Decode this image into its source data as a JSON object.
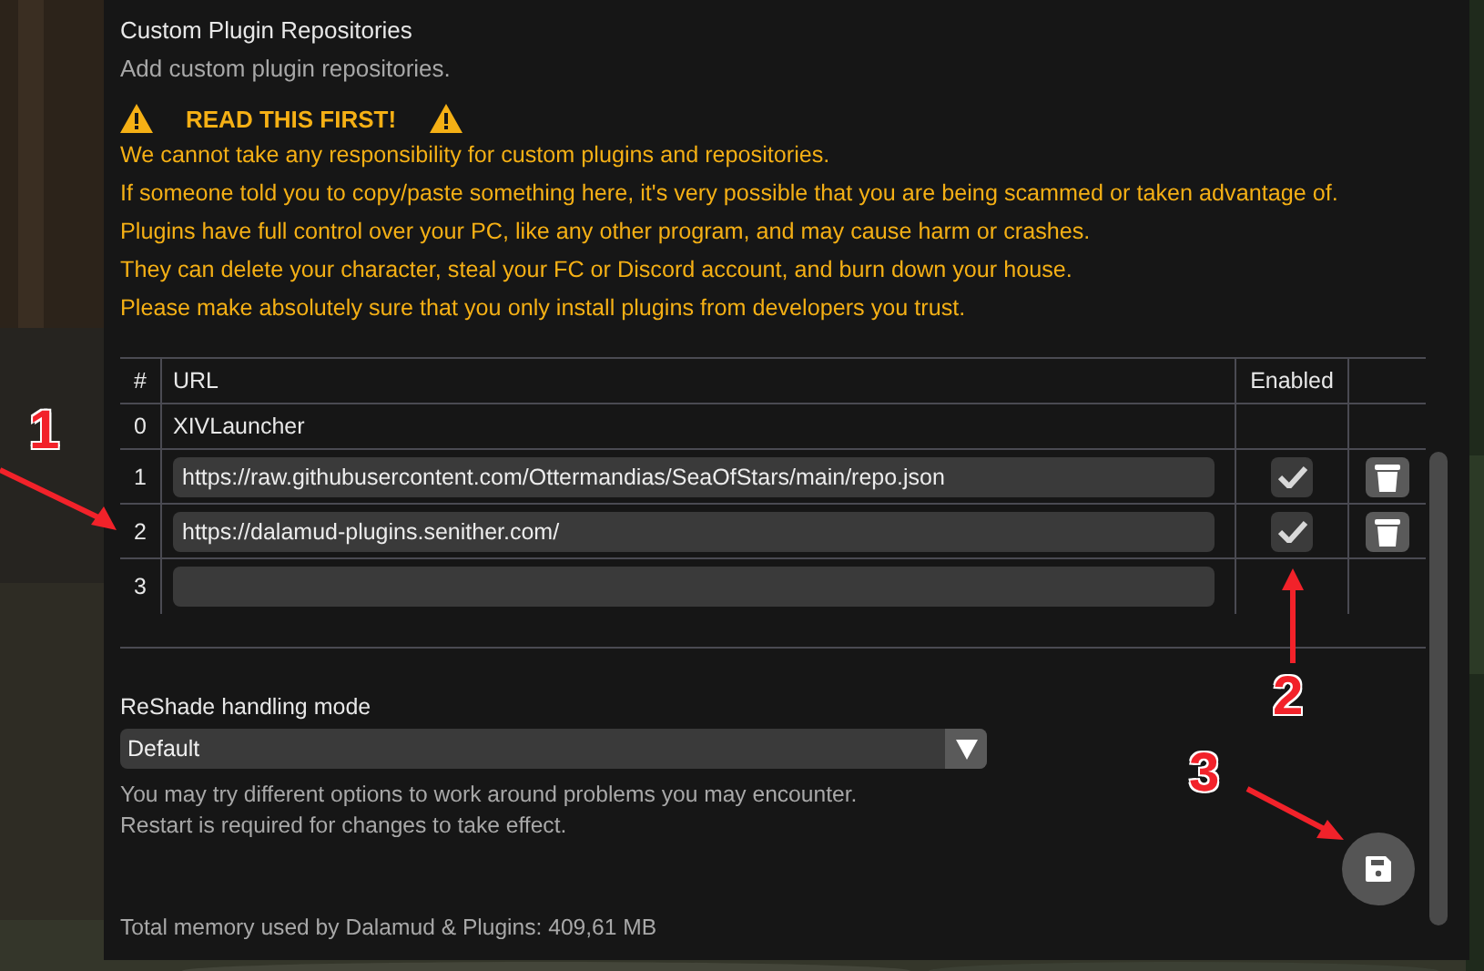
{
  "section": {
    "title": "Custom Plugin Repositories",
    "description": "Add custom plugin repositories."
  },
  "warning": {
    "heading": "READ THIS FIRST!",
    "lines": [
      "We cannot take any responsibility for custom plugins and repositories.",
      "If someone told you to copy/paste something here, it's very possible that you are being scammed or taken advantage of.",
      "Plugins have full control over your PC, like any other program, and may cause harm or crashes.",
      "They can delete your character, steal your FC or Discord account, and burn down your house.",
      "Please make absolutely sure that you only install plugins from developers you trust."
    ]
  },
  "table": {
    "columns": [
      "#",
      "URL",
      "Enabled"
    ],
    "rows": [
      {
        "index": "0",
        "kind": "fixed",
        "url": "XIVLauncher"
      },
      {
        "index": "1",
        "kind": "repo",
        "url": "https://raw.githubusercontent.com/Ottermandias/SeaOfStars/main/repo.json",
        "enabled": true
      },
      {
        "index": "2",
        "kind": "repo",
        "url": "https://dalamud-plugins.senither.com/",
        "enabled": true
      },
      {
        "index": "3",
        "kind": "new"
      }
    ]
  },
  "reshade": {
    "label": "ReShade handling mode",
    "value": "Default",
    "help": [
      "You may try different options to work around problems you may encounter.",
      "Restart is required for changes to take effect."
    ]
  },
  "memory": "Total memory used by Dalamud & Plugins: 409,61 MB",
  "annotations": [
    {
      "label": "1"
    },
    {
      "label": "2"
    },
    {
      "label": "3"
    }
  ]
}
